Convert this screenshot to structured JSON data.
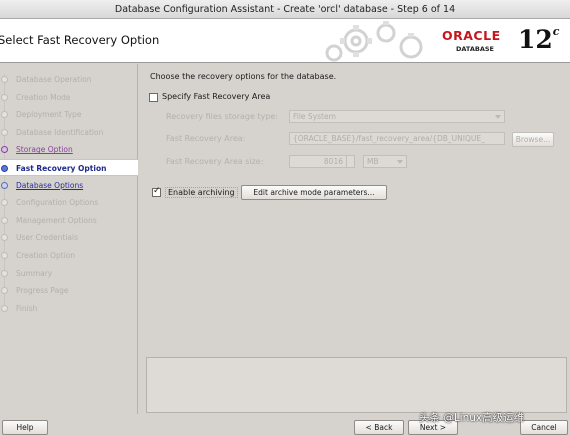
{
  "window": {
    "title": "Database Configuration Assistant - Create 'orcl' database - Step 6 of 14"
  },
  "banner": {
    "page_title": "Select Fast Recovery Option",
    "brand": "ORACLE",
    "product": "DATABASE",
    "version": "12",
    "version_suffix": "c"
  },
  "sidebar": {
    "steps": [
      {
        "label": "Database Operation",
        "state": "disabled"
      },
      {
        "label": "Creation Mode",
        "state": "disabled"
      },
      {
        "label": "Deployment Type",
        "state": "disabled"
      },
      {
        "label": "Database Identification",
        "state": "disabled"
      },
      {
        "label": "Storage Option",
        "state": "done"
      },
      {
        "label": "Fast Recovery Option",
        "state": "current"
      },
      {
        "label": "Database Options",
        "state": "link"
      },
      {
        "label": "Configuration Options",
        "state": "disabled"
      },
      {
        "label": "Management Options",
        "state": "disabled"
      },
      {
        "label": "User Credentials",
        "state": "disabled"
      },
      {
        "label": "Creation Option",
        "state": "disabled"
      },
      {
        "label": "Summary",
        "state": "disabled"
      },
      {
        "label": "Progress Page",
        "state": "disabled"
      },
      {
        "label": "Finish",
        "state": "disabled"
      }
    ]
  },
  "main": {
    "intro": "Choose the recovery options for the database.",
    "specify_fra_label": "Specify Fast Recovery Area",
    "specify_fra_checked": false,
    "storage_type_label": "Recovery files storage type:",
    "storage_type_value": "File System",
    "fra_label": "Fast Recovery Area:",
    "fra_value": "{ORACLE_BASE}/fast_recovery_area/{DB_UNIQUE_",
    "browse_label": "Browse...",
    "fra_size_label": "Fast Recovery Area size:",
    "fra_size_value": "8016",
    "fra_size_unit": "MB",
    "enable_archiving_label": "Enable archiving",
    "enable_archiving_checked": true,
    "edit_archive_label": "Edit archive mode parameters..."
  },
  "footer": {
    "help_label": "Help",
    "back_label": "< Back",
    "next_label": "Next >",
    "cancel_label": "Cancel"
  },
  "watermark": "头条 @Linux高级运维"
}
